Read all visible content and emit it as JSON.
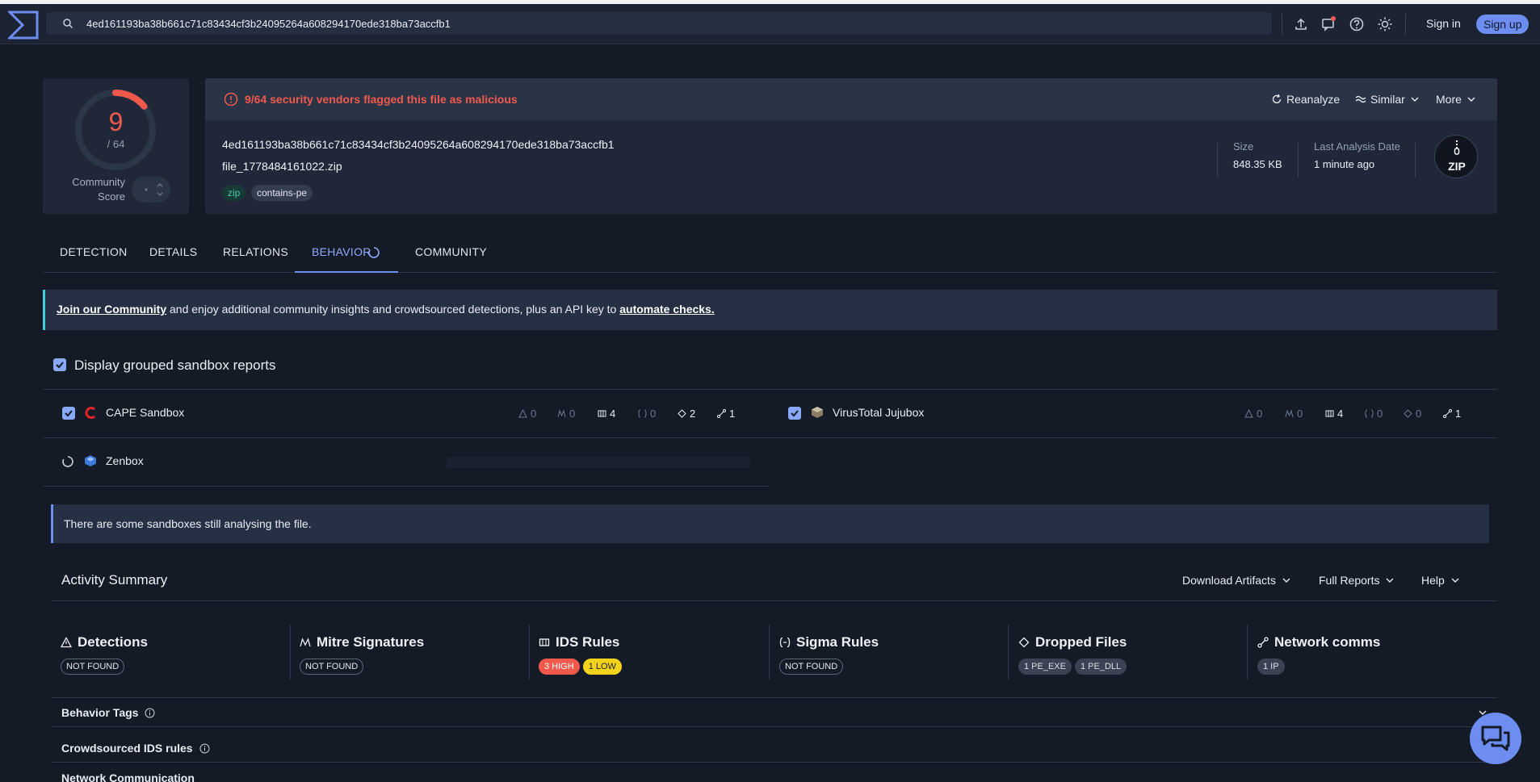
{
  "header": {
    "search_value": "4ed161193ba38b661c71c83434cf3b24095264a608294170ede318ba73accfb1",
    "sign_in": "Sign in",
    "sign_up": "Sign up"
  },
  "score": {
    "detected": "9",
    "total": "/ 64",
    "community_label_line1": "Community",
    "community_label_line2": "Score",
    "ratio": 0.14
  },
  "file": {
    "alert": "9/64 security vendors flagged this file as malicious",
    "reanalyze": "Reanalyze",
    "similar": "Similar",
    "more": "More",
    "hash": "4ed161193ba38b661c71c83434cf3b24095264a608294170ede318ba73accfb1",
    "name": "file_1778484161022.zip",
    "tags": [
      "zip",
      "contains-pe"
    ],
    "size_label": "Size",
    "size_value": "848.35 KB",
    "date_label": "Last Analysis Date",
    "date_value": "1 minute ago",
    "type_badge": "ZIP"
  },
  "tabs": [
    "DETECTION",
    "DETAILS",
    "RELATIONS",
    "BEHAVIOR",
    "COMMUNITY"
  ],
  "community_banner": {
    "link1": "Join our Community",
    "middle": " and enjoy additional community insights and crowdsourced detections, plus an API key to ",
    "link2": "automate checks."
  },
  "grouped_label": "Display grouped sandbox reports",
  "sandboxes": [
    {
      "name": "CAPE Sandbox",
      "stats": [
        "0",
        "0",
        "4",
        "0",
        "2",
        "1"
      ]
    },
    {
      "name": "VirusTotal Jujubox",
      "stats": [
        "0",
        "0",
        "4",
        "0",
        "0",
        "1"
      ]
    },
    {
      "name": "Zenbox"
    }
  ],
  "info_banner": "There are some sandboxes still analysing the file.",
  "activity": {
    "title": "Activity Summary",
    "download": "Download Artifacts",
    "full_reports": "Full Reports",
    "help": "Help",
    "cards": [
      {
        "title": "Detections",
        "icon": "warning-icon",
        "badges": [
          "NOT FOUND"
        ]
      },
      {
        "title": "Mitre Signatures",
        "icon": "mitre-icon",
        "badges": [
          "NOT FOUND"
        ]
      },
      {
        "title": "IDS Rules",
        "icon": "ids-icon",
        "badges": [
          "3 HIGH",
          "1 LOW"
        ]
      },
      {
        "title": "Sigma Rules",
        "icon": "sigma-icon",
        "badges": [
          "NOT FOUND"
        ]
      },
      {
        "title": "Dropped Files",
        "icon": "dropped-files-icon",
        "badges": [
          "1 PE_EXE",
          "1 PE_DLL"
        ]
      },
      {
        "title": "Network comms",
        "icon": "network-icon",
        "badges": [
          "1 IP"
        ]
      }
    ]
  },
  "sections": [
    "Behavior Tags",
    "Crowdsourced IDS rules",
    "Network Communication"
  ],
  "colors": {
    "accent": "#6d8ef0",
    "malicious": "#f1594c",
    "background": "#141a26"
  }
}
